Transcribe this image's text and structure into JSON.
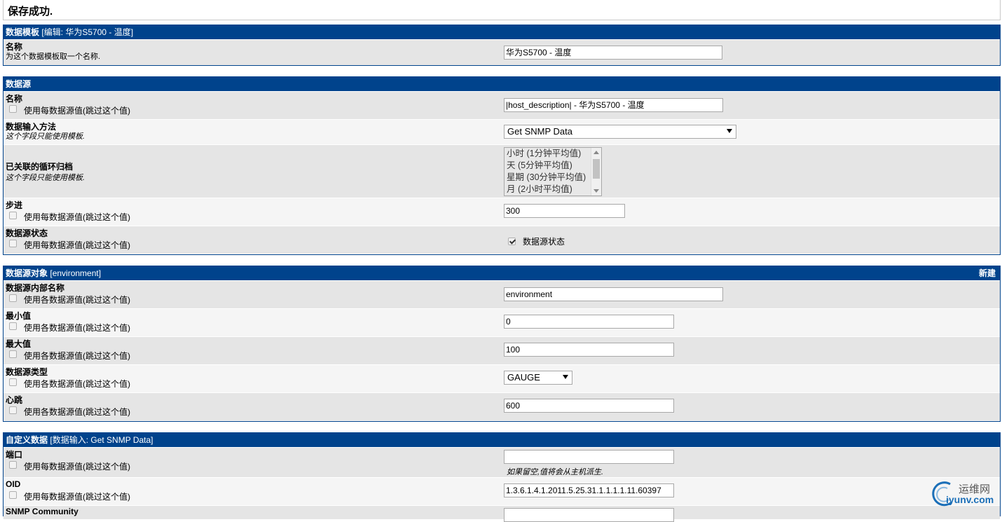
{
  "message": "保存成功.",
  "template": {
    "header_label": "数据模板",
    "header_detail": "[编辑: 华为S5700 - 温度]",
    "name_label": "名称",
    "name_desc": "为这个数据模板取一个名称.",
    "name_value": "华为S5700 - 温度"
  },
  "data_source": {
    "header_label": "数据源",
    "name_label": "名称",
    "name_check": "使用每数据源值(跳过这个值)",
    "name_value": "|host_description| - 华为S5700 - 温度",
    "input_label": "数据输入方法",
    "input_desc": "这个字段只能使用模板.",
    "input_value": "Get SNMP Data",
    "rra_label": "已关联的循环归档",
    "rra_desc": "这个字段只能使用模板.",
    "rra_options": [
      "小时 (1分钟平均值)",
      "天 (5分钟平均值)",
      "星期 (30分钟平均值)",
      "月 (2小时平均值)"
    ],
    "step_label": "步进",
    "step_check": "使用每数据源值(跳过这个值)",
    "step_value": "300",
    "status_label": "数据源状态",
    "status_check": "使用每数据源值(跳过这个值)",
    "status_value_label": "数据源状态"
  },
  "ds_item": {
    "header_label": "数据源对象",
    "header_detail": "[environment]",
    "new_label": "新建",
    "internal_label": "数据源内部名称",
    "internal_check": "使用各数据源值(跳过这个值)",
    "internal_value": "environment",
    "min_label": "最小值",
    "min_check": "使用各数据源值(跳过这个值)",
    "min_value": "0",
    "max_label": "最大值",
    "max_check": "使用各数据源值(跳过这个值)",
    "max_value": "100",
    "type_label": "数据源类型",
    "type_check": "使用各数据源值(跳过这个值)",
    "type_value": "GAUGE",
    "heartbeat_label": "心跳",
    "heartbeat_check": "使用各数据源值(跳过这个值)",
    "heartbeat_value": "600"
  },
  "custom": {
    "header_label": "自定义数据",
    "header_detail": "[数据输入: Get SNMP Data]",
    "port_label": "端口",
    "port_check": "使用每数据源值(跳过这个值)",
    "port_value": "",
    "port_hint": "如果留空,值将会从主机派生.",
    "oid_label": "OID",
    "oid_check": "使用每数据源值(跳过这个值)",
    "oid_value": "1.3.6.1.4.1.2011.5.25.31.1.1.1.1.11.60397",
    "community_label": "SNMP Community"
  },
  "watermark": {
    "line1": "运维网",
    "line2": "iyunv.com"
  }
}
